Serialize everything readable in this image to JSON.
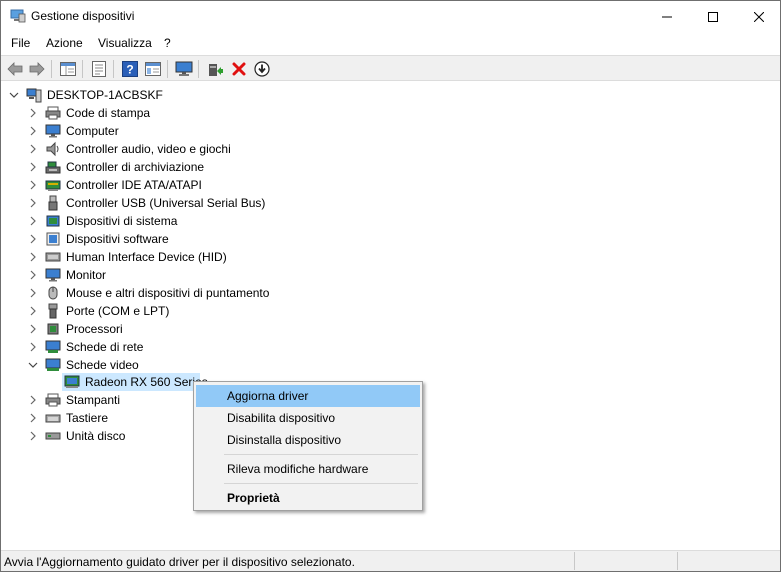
{
  "window": {
    "title": "Gestione dispositivi"
  },
  "menubar": {
    "items": [
      "File",
      "Azione",
      "Visualizza",
      "?"
    ]
  },
  "tree": {
    "root": "DESKTOP-1ACBSKF",
    "categories": [
      "Code di stampa",
      "Computer",
      "Controller audio, video e giochi",
      "Controller di archiviazione",
      "Controller IDE ATA/ATAPI",
      "Controller USB (Universal Serial Bus)",
      "Dispositivi di sistema",
      "Dispositivi software",
      "Human Interface Device (HID)",
      "Monitor",
      "Mouse e altri dispositivi di puntamento",
      "Porte (COM e LPT)",
      "Processori",
      "Schede di rete",
      "Schede video"
    ],
    "expanded_child": "Radeon RX 560 Series",
    "after_categories": [
      "Stampanti",
      "Tastiere",
      "Unità disco"
    ]
  },
  "context_menu": {
    "items": [
      "Aggiorna driver",
      "Disabilita dispositivo",
      "Disinstalla dispositivo",
      "Rileva modifiche hardware",
      "Proprietà"
    ]
  },
  "status": {
    "text": "Avvia l'Aggiornamento guidato driver per il dispositivo selezionato."
  },
  "colors": {
    "selection": "#cce8ff",
    "menu_highlight": "#91c9f7",
    "toolbar": "#f0f0f0"
  }
}
